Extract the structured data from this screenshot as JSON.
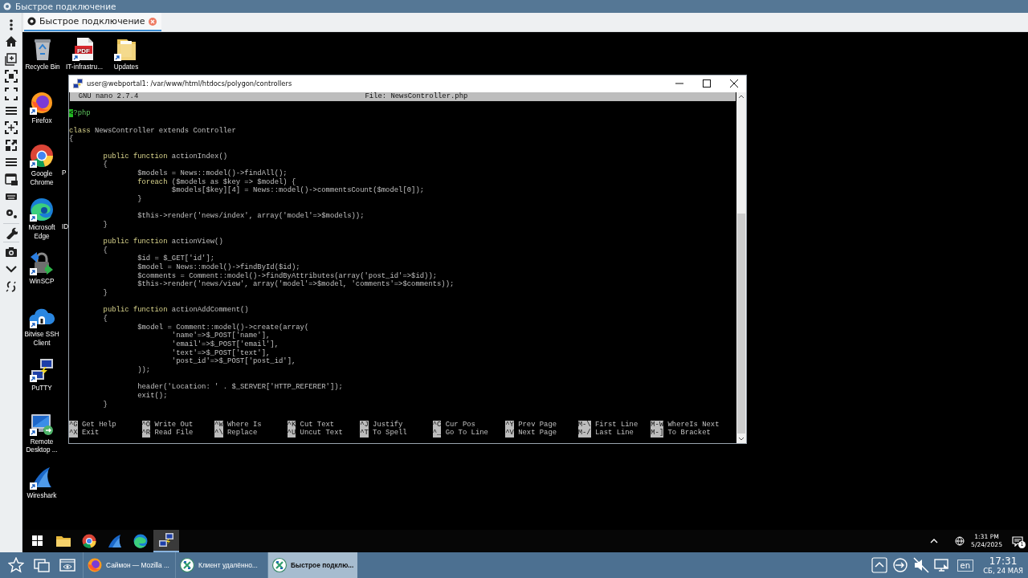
{
  "app": {
    "title": "Быстрое подключение"
  },
  "tabs": [
    {
      "label": "Быстрое подключение",
      "selected": true
    }
  ],
  "desktop_icons": [
    {
      "label": "Recycle Bin",
      "kind": "bin",
      "shortcut": false
    },
    {
      "label": "IT-infrastru...",
      "kind": "pdf",
      "icon_text": "PDF",
      "shortcut": true
    },
    {
      "label": "Updates",
      "kind": "folder",
      "shortcut": true
    },
    {
      "label": "Firefox",
      "kind": "firefox",
      "shortcut": true
    },
    {
      "label": "Google Chrome",
      "kind": "chrome",
      "shortcut": true
    },
    {
      "label": "Microsoft Edge",
      "kind": "edge",
      "shortcut": true
    },
    {
      "label": "WinSCP",
      "kind": "winscp",
      "shortcut": true
    },
    {
      "label": "Bitvise SSH Client",
      "kind": "bitvise",
      "shortcut": true
    },
    {
      "label": "PuTTY",
      "kind": "putty",
      "shortcut": true
    },
    {
      "label": "Remote Desktop ...",
      "kind": "rdp",
      "shortcut": true
    },
    {
      "label": "Wireshark",
      "kind": "shark",
      "shortcut": true
    }
  ],
  "peeking_labels": [
    "P",
    "ID"
  ],
  "putty": {
    "title": "user@webportal1: /var/www/html/htdocs/polygon/controllers",
    "version": "GNU nano 2.7.4",
    "file": "File: NewsController.php",
    "lines": [
      {
        "kind": "code",
        "segments": [
          {
            "text": "<",
            "kind": "cursor"
          },
          {
            "text": "?php",
            "kind": "tag"
          }
        ]
      },
      {
        "kind": "blank"
      },
      {
        "kind": "code",
        "segments": [
          {
            "text": "class",
            "kind": "keyword"
          },
          {
            "text": " NewsController extends Controller",
            "kind": "plain"
          }
        ]
      },
      {
        "kind": "code",
        "segments": [
          {
            "text": "{",
            "kind": "plain"
          }
        ]
      },
      {
        "kind": "blank"
      },
      {
        "kind": "code",
        "segments": [
          {
            "text": "\tpublic function",
            "kind": "keyword"
          },
          {
            "text": " actionIndex()",
            "kind": "plain"
          }
        ]
      },
      {
        "kind": "code",
        "segments": [
          {
            "text": "\t{",
            "kind": "plain"
          }
        ]
      },
      {
        "kind": "code",
        "segments": [
          {
            "text": "\t\t$models = News::model()->findAll();",
            "kind": "plain"
          }
        ]
      },
      {
        "kind": "code",
        "segments": [
          {
            "text": "\t\tforeach",
            "kind": "keyword"
          },
          {
            "text": " ($models as $key => $model) {",
            "kind": "plain"
          }
        ]
      },
      {
        "kind": "code",
        "segments": [
          {
            "text": "\t\t\t$models[$key][4] = News::model()->commentsCount($model[0]);",
            "kind": "plain"
          }
        ]
      },
      {
        "kind": "code",
        "segments": [
          {
            "text": "\t\t}",
            "kind": "plain"
          }
        ]
      },
      {
        "kind": "blank"
      },
      {
        "kind": "code",
        "segments": [
          {
            "text": "\t\t$this->render('news/index', array('model'=>$models));",
            "kind": "plain"
          }
        ]
      },
      {
        "kind": "code",
        "segments": [
          {
            "text": "\t}",
            "kind": "plain"
          }
        ]
      },
      {
        "kind": "blank"
      },
      {
        "kind": "code",
        "segments": [
          {
            "text": "\tpublic function",
            "kind": "keyword"
          },
          {
            "text": " actionView()",
            "kind": "plain"
          }
        ]
      },
      {
        "kind": "code",
        "segments": [
          {
            "text": "\t{",
            "kind": "plain"
          }
        ]
      },
      {
        "kind": "code",
        "segments": [
          {
            "text": "\t\t$id = $_GET['id'];",
            "kind": "plain"
          }
        ]
      },
      {
        "kind": "code",
        "segments": [
          {
            "text": "\t\t$model = News::model()->findById($id);",
            "kind": "plain"
          }
        ]
      },
      {
        "kind": "code",
        "segments": [
          {
            "text": "\t\t$comments = Comment::model()->findByAttributes(array('post_id'=>$id));",
            "kind": "plain"
          }
        ]
      },
      {
        "kind": "code",
        "segments": [
          {
            "text": "\t\t$this->render('news/view', array('model'=>$model, 'comments'=>$comments));",
            "kind": "plain"
          }
        ]
      },
      {
        "kind": "code",
        "segments": [
          {
            "text": "\t}",
            "kind": "plain"
          }
        ]
      },
      {
        "kind": "blank"
      },
      {
        "kind": "code",
        "segments": [
          {
            "text": "\tpublic function",
            "kind": "keyword"
          },
          {
            "text": " actionAddComment()",
            "kind": "plain"
          }
        ]
      },
      {
        "kind": "code",
        "segments": [
          {
            "text": "\t{",
            "kind": "plain"
          }
        ]
      },
      {
        "kind": "code",
        "segments": [
          {
            "text": "\t\t$model = Comment::model()->create(array(",
            "kind": "plain"
          }
        ]
      },
      {
        "kind": "code",
        "segments": [
          {
            "text": "\t\t\t'name'=>$_POST['name'],",
            "kind": "plain"
          }
        ]
      },
      {
        "kind": "code",
        "segments": [
          {
            "text": "\t\t\t'email'=>$_POST['email'],",
            "kind": "plain"
          }
        ]
      },
      {
        "kind": "code",
        "segments": [
          {
            "text": "\t\t\t'text'=>$_POST['text'],",
            "kind": "plain"
          }
        ]
      },
      {
        "kind": "code",
        "segments": [
          {
            "text": "\t\t\t'post_id'=>$_POST['post_id'],",
            "kind": "plain"
          }
        ]
      },
      {
        "kind": "code",
        "segments": [
          {
            "text": "\t\t));",
            "kind": "plain"
          }
        ]
      },
      {
        "kind": "blank"
      },
      {
        "kind": "code",
        "segments": [
          {
            "text": "\t\theader('Location: ' . $_SERVER['HTTP_REFERER']);",
            "kind": "plain"
          }
        ]
      },
      {
        "kind": "code",
        "segments": [
          {
            "text": "\t\texit();",
            "kind": "plain"
          }
        ]
      },
      {
        "kind": "code",
        "segments": [
          {
            "text": "\t}",
            "kind": "plain"
          }
        ]
      }
    ],
    "shortcut_rows": [
      [
        {
          "key": "^G",
          "label": "Get Help"
        },
        {
          "key": "^O",
          "label": "Write Out"
        },
        {
          "key": "^W",
          "label": "Where Is"
        },
        {
          "key": "^K",
          "label": "Cut Text"
        },
        {
          "key": "^J",
          "label": "Justify"
        },
        {
          "key": "^C",
          "label": "Cur Pos"
        },
        {
          "key": "^Y",
          "label": "Prev Page"
        },
        {
          "key": "M-\\",
          "label": "First Line"
        },
        {
          "key": "M-W",
          "label": "WhereIs Next"
        }
      ],
      [
        {
          "key": "^X",
          "label": "Exit"
        },
        {
          "key": "^R",
          "label": "Read File"
        },
        {
          "key": "^\\",
          "label": "Replace"
        },
        {
          "key": "^U",
          "label": "Uncut Text"
        },
        {
          "key": "^T",
          "label": "To Spell"
        },
        {
          "key": "^_",
          "label": "Go To Line"
        },
        {
          "key": "^V",
          "label": "Next Page"
        },
        {
          "key": "M-/",
          "label": "Last Line"
        },
        {
          "key": "M-]",
          "label": "To Bracket"
        }
      ]
    ]
  },
  "remote_taskbar": {
    "items": [
      {
        "kind": "windows",
        "selected": false
      },
      {
        "kind": "folder",
        "selected": false
      },
      {
        "kind": "chrome",
        "selected": false
      },
      {
        "kind": "shark",
        "selected": false
      },
      {
        "kind": "edge",
        "selected": false
      },
      {
        "kind": "putty",
        "selected": true
      }
    ],
    "time": "1:31 PM",
    "date": "5/24/2025",
    "notifications": "1"
  },
  "host_taskbar": {
    "tasks": [
      {
        "label": "Саймон — Mozilla ...",
        "kind": "firefox",
        "selected": false
      },
      {
        "label": "Клиент удалённо...",
        "kind": "remmina",
        "selected": false
      },
      {
        "label": "Быстрое подклю...",
        "kind": "remmina",
        "selected": true
      }
    ],
    "language": "en",
    "time": "17:31",
    "date": "СБ, 24 МАЯ"
  }
}
